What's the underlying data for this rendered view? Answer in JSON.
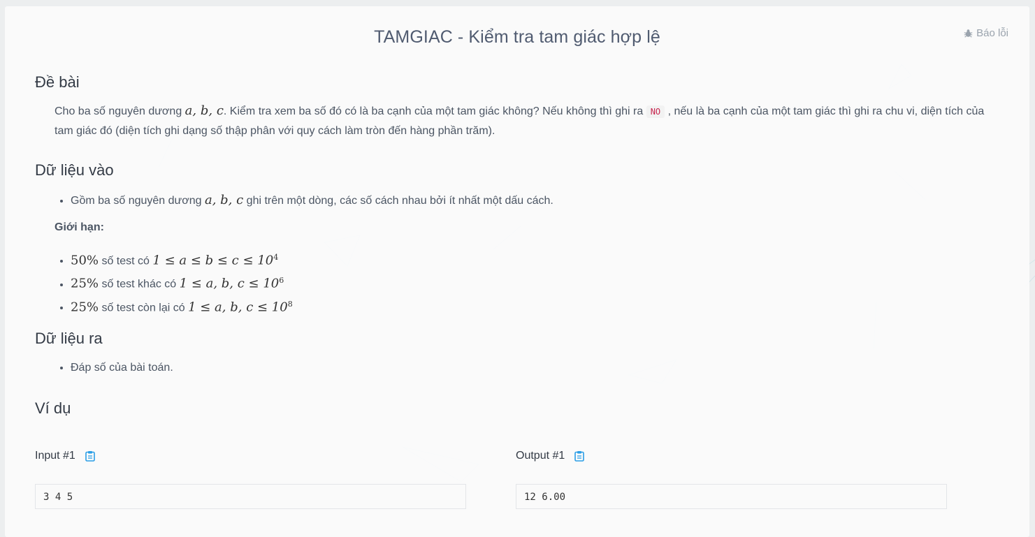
{
  "header": {
    "title": "TAMGIAC - Kiểm tra tam giác hợp lệ",
    "report_label": "Báo lỗi",
    "report_icon": "bug-icon"
  },
  "statement": {
    "heading": "Đề bài",
    "p1_a": "Cho ba số nguyên dương ",
    "p1_vars": "a, b, c",
    "p1_b": ". Kiểm tra xem ba số đó có là ba cạnh của một tam giác không? Nếu không thì ghi ra ",
    "no_code": "NO",
    "p1_c": " , nếu là ba cạnh của một tam giác thì ghi ra chu vi, diện tích của tam giác đó (diện tích ghi dạng số thập phân với quy cách làm tròn đến hàng phần trăm)."
  },
  "input": {
    "heading": "Dữ liệu vào",
    "item_a": "Gồm ba số nguyên dương ",
    "item_vars": "a, b, c",
    "item_b": " ghi trên một dòng, các số cách nhau bởi ít nhất một dấu cách.",
    "limits_label": "Giới hạn:",
    "limits": [
      {
        "pct": "50%",
        "text": " số test có ",
        "expr": "1 ≤ a ≤ b ≤ c ≤ 10",
        "exp": "4"
      },
      {
        "pct": "25%",
        "text": " số test khác có ",
        "expr": "1 ≤ a, b, c ≤ 10",
        "exp": "6"
      },
      {
        "pct": "25%",
        "text": " số test còn lại có ",
        "expr": "1 ≤ a, b, c ≤ 10",
        "exp": "8"
      }
    ]
  },
  "output": {
    "heading": "Dữ liệu ra",
    "item": "Đáp số của bài toán."
  },
  "examples": {
    "heading": "Ví dụ",
    "input_label": "Input #1",
    "output_label": "Output #1",
    "input_value": "3 4 5",
    "output_value": "12 6.00",
    "copy_icon": "clipboard-icon",
    "accent": "#2b9ee6"
  }
}
